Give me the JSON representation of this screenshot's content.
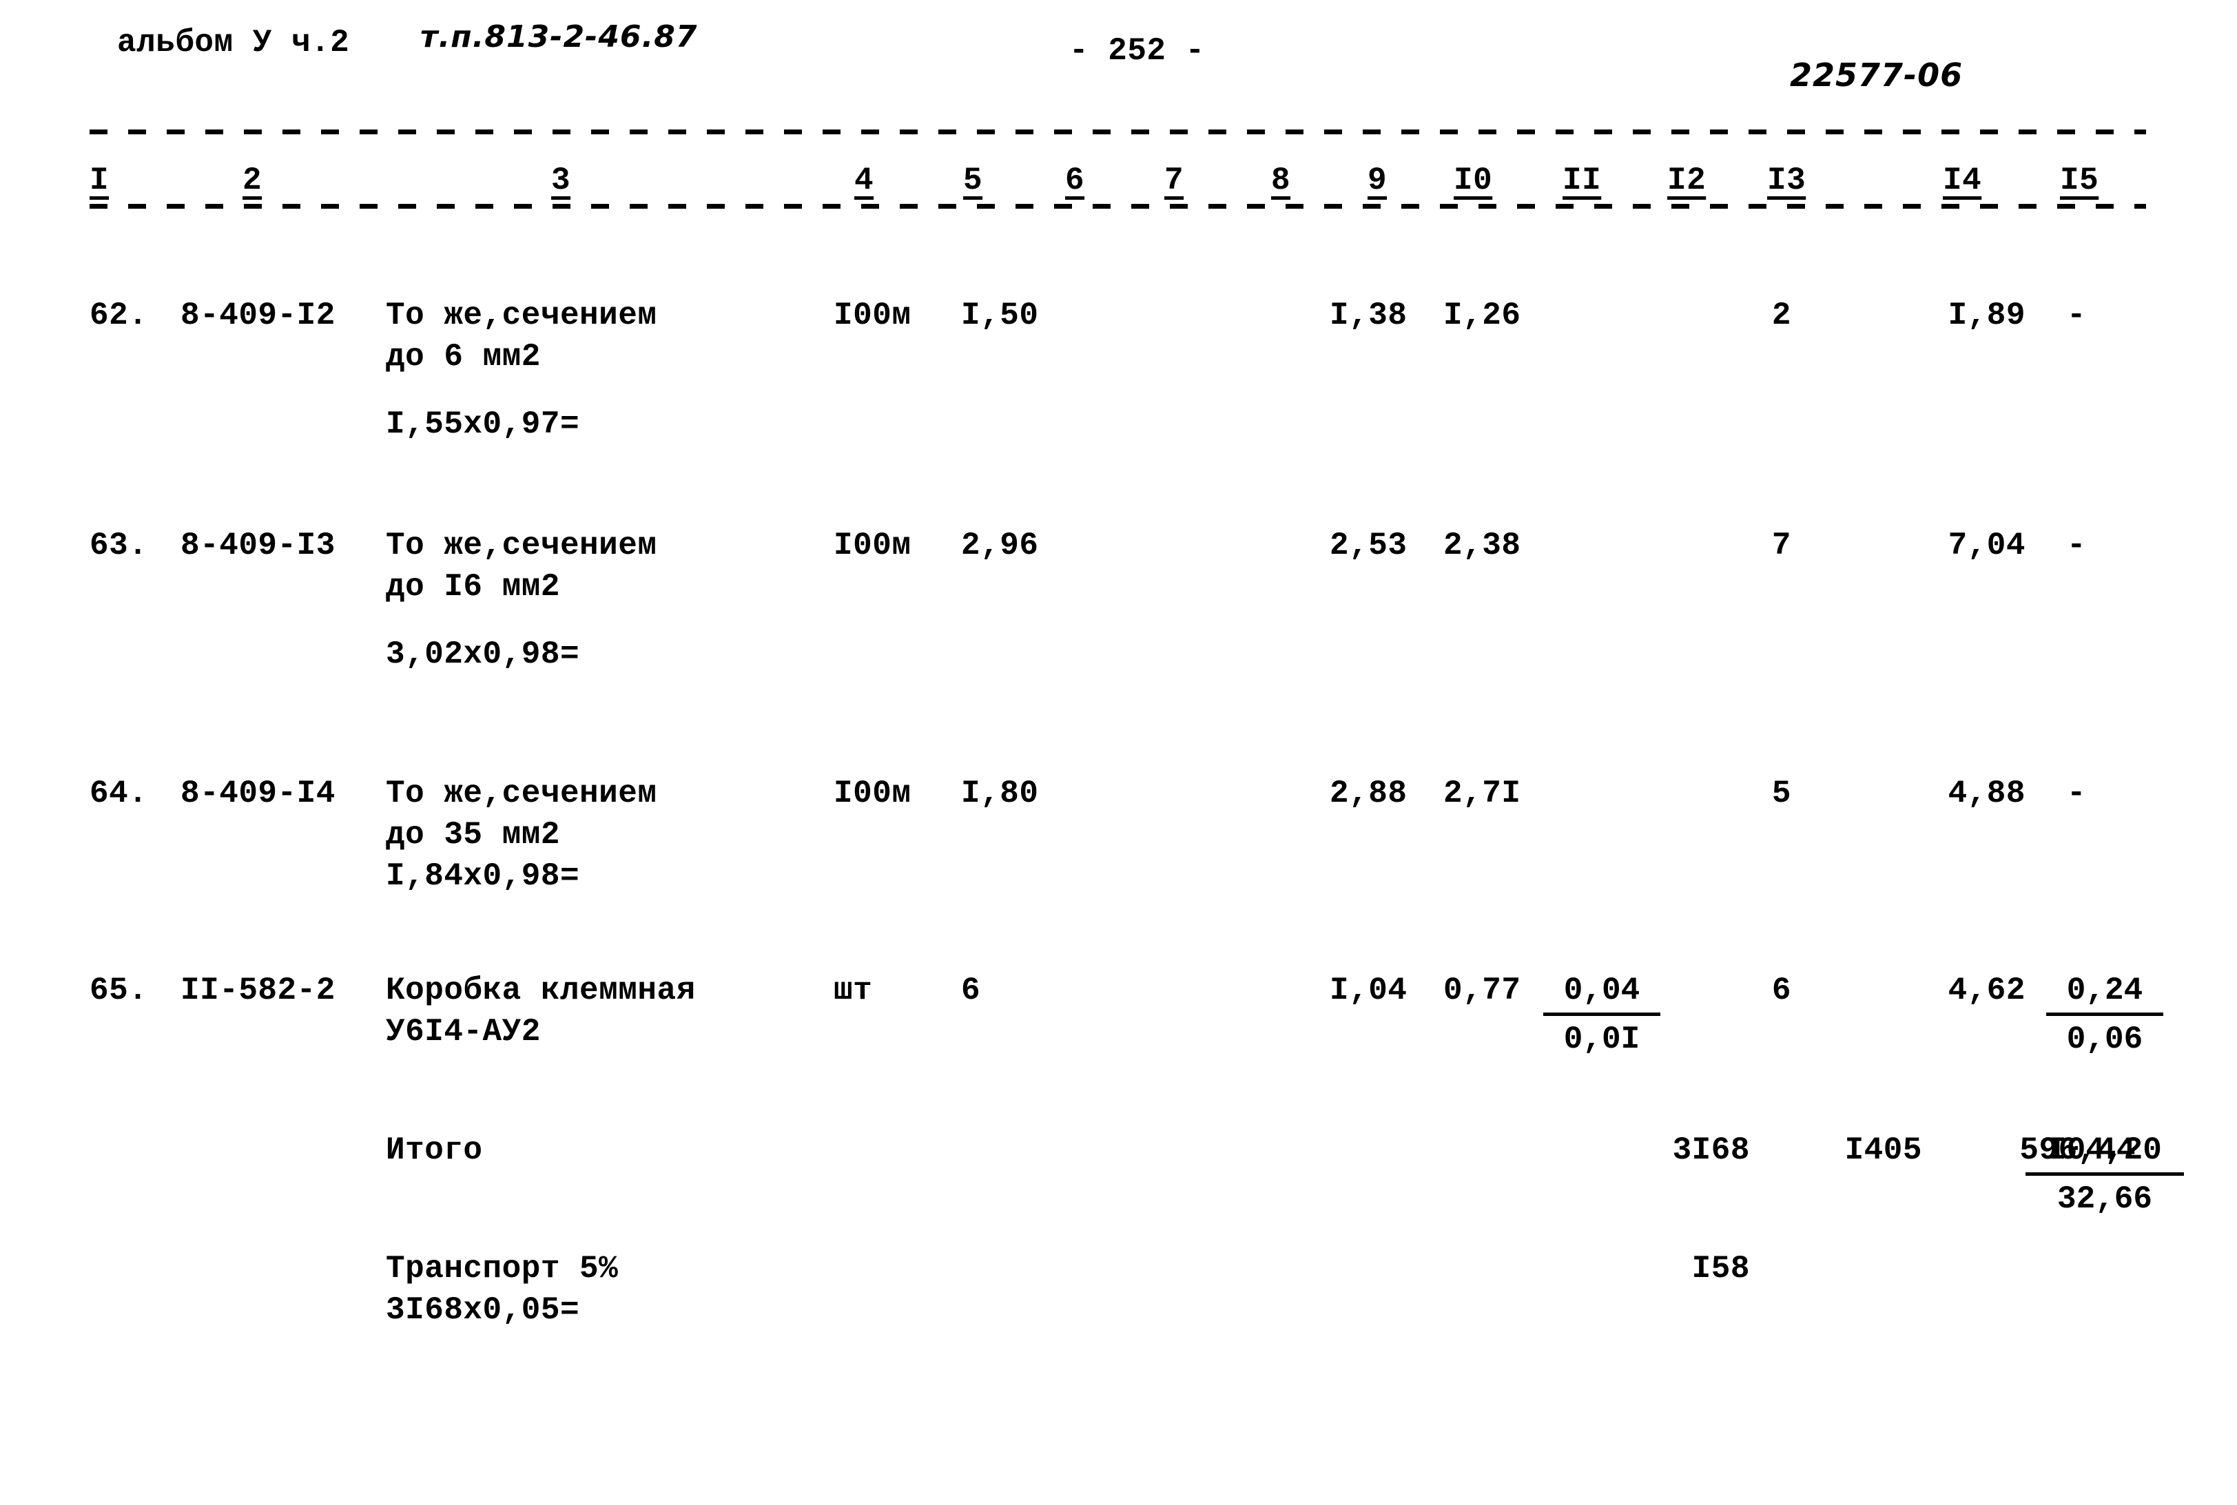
{
  "header": {
    "album_label": "альбом У ч.2",
    "album_code": "т.п.813-2-46.87",
    "page_number": "- 252 -",
    "doc_code": "22577-06"
  },
  "column_numbers": [
    "I",
    "2",
    "3",
    "4",
    "5",
    "6",
    "7",
    "8",
    "9",
    "I0",
    "II",
    "I2",
    "I3",
    "I4",
    "I5"
  ],
  "rows": [
    {
      "no": "62.",
      "code": "8-409-I2",
      "name_line1": "То же,сечением",
      "name_line2": "до 6 мм2",
      "calc": "I,55x0,97=",
      "unit": "I00м",
      "qty": "I,50",
      "c9": "I,38",
      "c10": "I,26",
      "c11_num": "",
      "c11_den": "",
      "c13": "2",
      "c14": "I,89",
      "c15_num": "-",
      "c15_den": ""
    },
    {
      "no": "63.",
      "code": "8-409-I3",
      "name_line1": "То же,сечением",
      "name_line2": "до I6 мм2",
      "calc": "3,02x0,98=",
      "unit": "I00м",
      "qty": "2,96",
      "c9": "2,53",
      "c10": "2,38",
      "c11_num": "",
      "c11_den": "",
      "c13": "7",
      "c14": "7,04",
      "c15_num": "-",
      "c15_den": ""
    },
    {
      "no": "64.",
      "code": "8-409-I4",
      "name_line1": "То же,сечением",
      "name_line2": "до 35 мм2",
      "calc": "I,84x0,98=",
      "unit": "I00м",
      "qty": "I,80",
      "c9": "2,88",
      "c10": "2,7I",
      "c11_num": "",
      "c11_den": "",
      "c13": "5",
      "c14": "4,88",
      "c15_num": "-",
      "c15_den": ""
    },
    {
      "no": "65.",
      "code": "II-582-2",
      "name_line1": "Коробка клеммная",
      "name_line2": "У6I4-АУ2",
      "calc": "",
      "unit": "шт",
      "qty": "6",
      "c9": "I,04",
      "c10": "0,77",
      "c11_num": "0,04",
      "c11_den": "0,0I",
      "c13": "6",
      "c14": "4,62",
      "c15_num": "0,24",
      "c15_den": "0,06"
    }
  ],
  "totals": {
    "label": "Итого",
    "c12": "3I68",
    "c13": "I405",
    "c14": "596,44",
    "c15_num": "I04,20",
    "c15_den": "32,66"
  },
  "transport": {
    "label": "Транспорт 5%",
    "calc": "3I68x0,05=",
    "c12": "I58"
  }
}
